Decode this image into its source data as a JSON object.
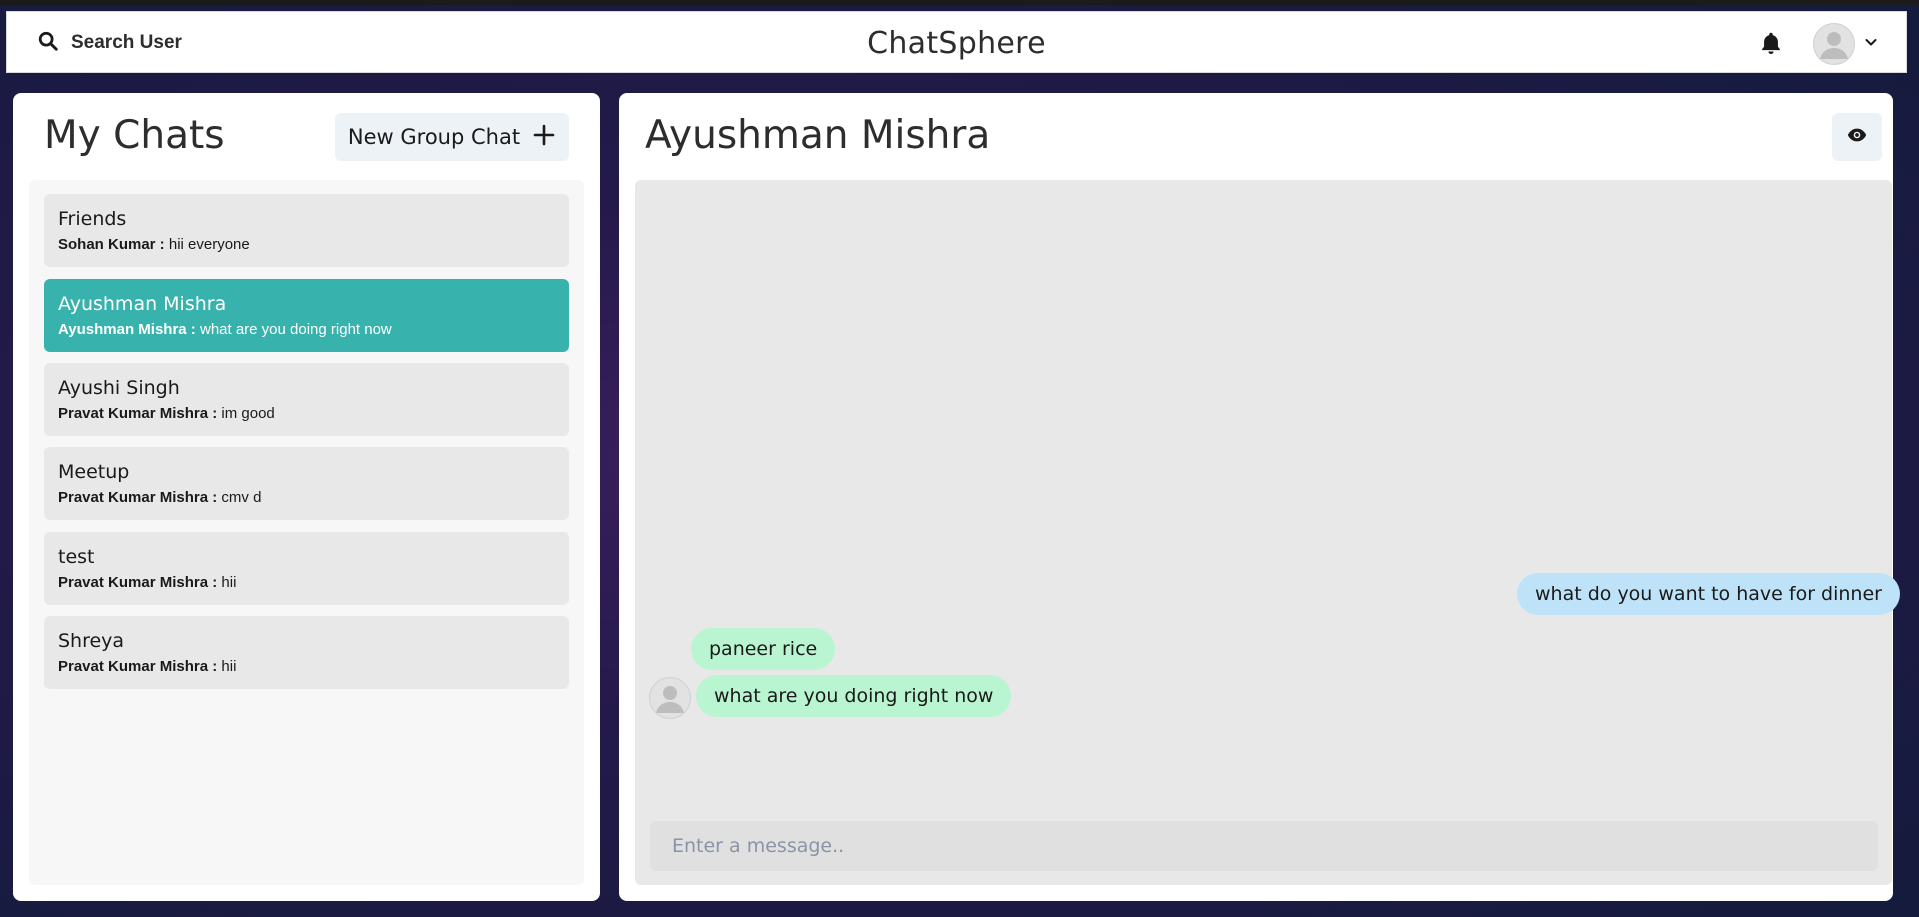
{
  "header": {
    "search_label": "Search User",
    "brand": "ChatSphere",
    "icons": {
      "search": "search-icon",
      "bell": "bell-icon",
      "avatar": "user-avatar-icon",
      "chevron": "chevron-down-icon"
    }
  },
  "sidebar": {
    "title": "My Chats",
    "new_group_label": "New Group Chat",
    "chats": [
      {
        "name": "Friends",
        "sender": "Sohan Kumar :",
        "message": "hii everyone",
        "active": false
      },
      {
        "name": "Ayushman Mishra",
        "sender": "Ayushman Mishra :",
        "message": "what are you doing right now",
        "active": true
      },
      {
        "name": "Ayushi Singh",
        "sender": "Pravat Kumar Mishra :",
        "message": "im good",
        "active": false
      },
      {
        "name": "Meetup",
        "sender": "Pravat Kumar Mishra :",
        "message": "cmv d",
        "active": false
      },
      {
        "name": "test",
        "sender": "Pravat Kumar Mishra :",
        "message": "hii",
        "active": false
      },
      {
        "name": "Shreya",
        "sender": "Pravat Kumar Mishra :",
        "message": "hii",
        "active": false
      }
    ]
  },
  "chat": {
    "title": "Ayushman Mishra",
    "messages": [
      {
        "text": "what do you want to have for dinner",
        "direction": "sent"
      },
      {
        "text": "paneer rice",
        "direction": "received"
      },
      {
        "text": "what are you doing right now",
        "direction": "received"
      }
    ],
    "input_placeholder": "Enter a message.."
  },
  "colors": {
    "active_chat": "#38b2ac",
    "sent_bubble": "#bee3f8",
    "received_bubble": "#b9f5d0",
    "button_bg": "#edf2f7"
  }
}
